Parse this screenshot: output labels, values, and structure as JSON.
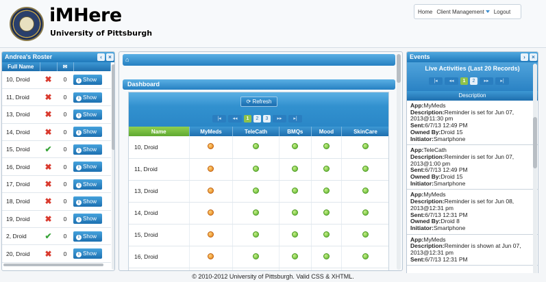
{
  "brand": {
    "title": "iMHere",
    "subtitle": "University of Pittsburgh"
  },
  "nav": {
    "home": "Home",
    "client_management": "Client Management",
    "logout": "Logout"
  },
  "roster": {
    "title": "Andrea's Roster",
    "columns": [
      "Full Name",
      "",
      "✉"
    ],
    "show_label": "Show",
    "rows": [
      {
        "name": "10, Droid",
        "status": "x",
        "count": "0"
      },
      {
        "name": "11, Droid",
        "status": "x",
        "count": "0"
      },
      {
        "name": "13, Droid",
        "status": "x",
        "count": "0"
      },
      {
        "name": "14, Droid",
        "status": "x",
        "count": "0"
      },
      {
        "name": "15, Droid",
        "status": "check",
        "count": "0"
      },
      {
        "name": "16, Droid",
        "status": "x",
        "count": "0"
      },
      {
        "name": "17, Droid",
        "status": "x",
        "count": "0"
      },
      {
        "name": "18, Droid",
        "status": "x",
        "count": "0"
      },
      {
        "name": "19, Droid",
        "status": "x",
        "count": "0"
      },
      {
        "name": "2, Droid",
        "status": "check",
        "count": "0"
      },
      {
        "name": "20, Droid",
        "status": "x",
        "count": "0"
      }
    ]
  },
  "dashboard": {
    "home_icon": "home-icon",
    "title": "Dashboard",
    "refresh_label": "Refresh",
    "pager": {
      "first": "|◂",
      "prev": "◂◂",
      "pages": [
        "1",
        "2",
        "3"
      ],
      "current": "1",
      "next": "▸▸",
      "last": "▸|"
    },
    "columns": [
      "Name",
      "MyMeds",
      "TeleCath",
      "BMQs",
      "Mood",
      "SkinCare"
    ],
    "rows": [
      {
        "name": "10, Droid",
        "cells": [
          "warn",
          "ok",
          "ok",
          "ok",
          "ok"
        ]
      },
      {
        "name": "11, Droid",
        "cells": [
          "warn",
          "ok",
          "ok",
          "ok",
          "ok"
        ]
      },
      {
        "name": "13, Droid",
        "cells": [
          "warn",
          "ok",
          "ok",
          "ok",
          "ok"
        ]
      },
      {
        "name": "14, Droid",
        "cells": [
          "warn",
          "ok",
          "ok",
          "ok",
          "ok"
        ]
      },
      {
        "name": "15, Droid",
        "cells": [
          "warn",
          "ok",
          "ok",
          "ok",
          "ok"
        ]
      },
      {
        "name": "16, Droid",
        "cells": [
          "warn",
          "ok",
          "ok",
          "ok",
          "ok"
        ]
      },
      {
        "name": "",
        "cells": [
          "warn",
          "ok",
          "ok",
          "ok",
          "ok"
        ]
      }
    ]
  },
  "events": {
    "title": "Events",
    "live_title": "Live Activities (Last 20 Records)",
    "pager": {
      "first": "|◂",
      "prev": "◂◂",
      "pages": [
        "1",
        "2"
      ],
      "current": "1",
      "next": "▸▸",
      "last": "▸|"
    },
    "description_header": "Description",
    "items": [
      {
        "app": "MyMeds",
        "description": "Reminder is set for Jun 07, 2013@11:30 pm",
        "sent": "6/7/13 12:49 PM",
        "owned_by": "Droid 15",
        "initiator": "Smartphone"
      },
      {
        "app": "TeleCath",
        "description": "Reminder is set for Jun 07, 2013@1:00 pm",
        "sent": "6/7/13 12:49 PM",
        "owned_by": "Droid 15",
        "initiator": "Smartphone"
      },
      {
        "app": "MyMeds",
        "description": "Reminder is set for Jun 08, 2013@12:31 pm",
        "sent": "6/7/13 12:31 PM",
        "owned_by": "Droid 8",
        "initiator": "Smartphone"
      },
      {
        "app": "MyMeds",
        "description": "Reminder is shown at Jun 07, 2013@12:31 pm",
        "sent": "6/7/13 12:31 PM",
        "owned_by": "",
        "initiator": ""
      }
    ],
    "labels": {
      "app": "App:",
      "description": "Description:",
      "sent": "Sent:",
      "owned_by": "Owned By:",
      "initiator": "Initiator:"
    }
  },
  "footer": "© 2010-2012 University of Pittsburgh. Valid CSS & XHTML."
}
